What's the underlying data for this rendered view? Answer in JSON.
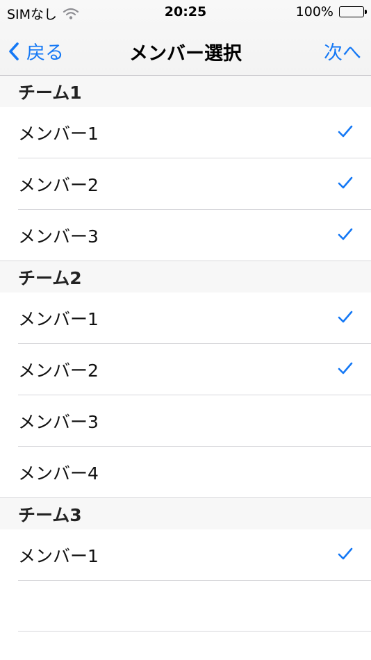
{
  "status_bar": {
    "carrier": "SIMなし",
    "time": "20:25",
    "battery": "100%",
    "battery_level": 1.0,
    "icons": [
      "wifi-icon",
      "battery-icon"
    ]
  },
  "nav": {
    "back_label": "戻る",
    "title": "メンバー選択",
    "next_label": "次へ"
  },
  "colors": {
    "accent": "#1478f5",
    "separator": "#d7d7db",
    "section_bg": "#f7f7f7"
  },
  "sections": [
    {
      "title": "チーム1",
      "members": [
        {
          "label": "メンバー1",
          "checked": true
        },
        {
          "label": "メンバー2",
          "checked": true
        },
        {
          "label": "メンバー3",
          "checked": true
        }
      ]
    },
    {
      "title": "チーム2",
      "members": [
        {
          "label": "メンバー1",
          "checked": true
        },
        {
          "label": "メンバー2",
          "checked": true
        },
        {
          "label": "メンバー3",
          "checked": false
        },
        {
          "label": "メンバー4",
          "checked": false
        }
      ]
    },
    {
      "title": "チーム3",
      "members": [
        {
          "label": "メンバー1",
          "checked": true
        }
      ]
    }
  ]
}
